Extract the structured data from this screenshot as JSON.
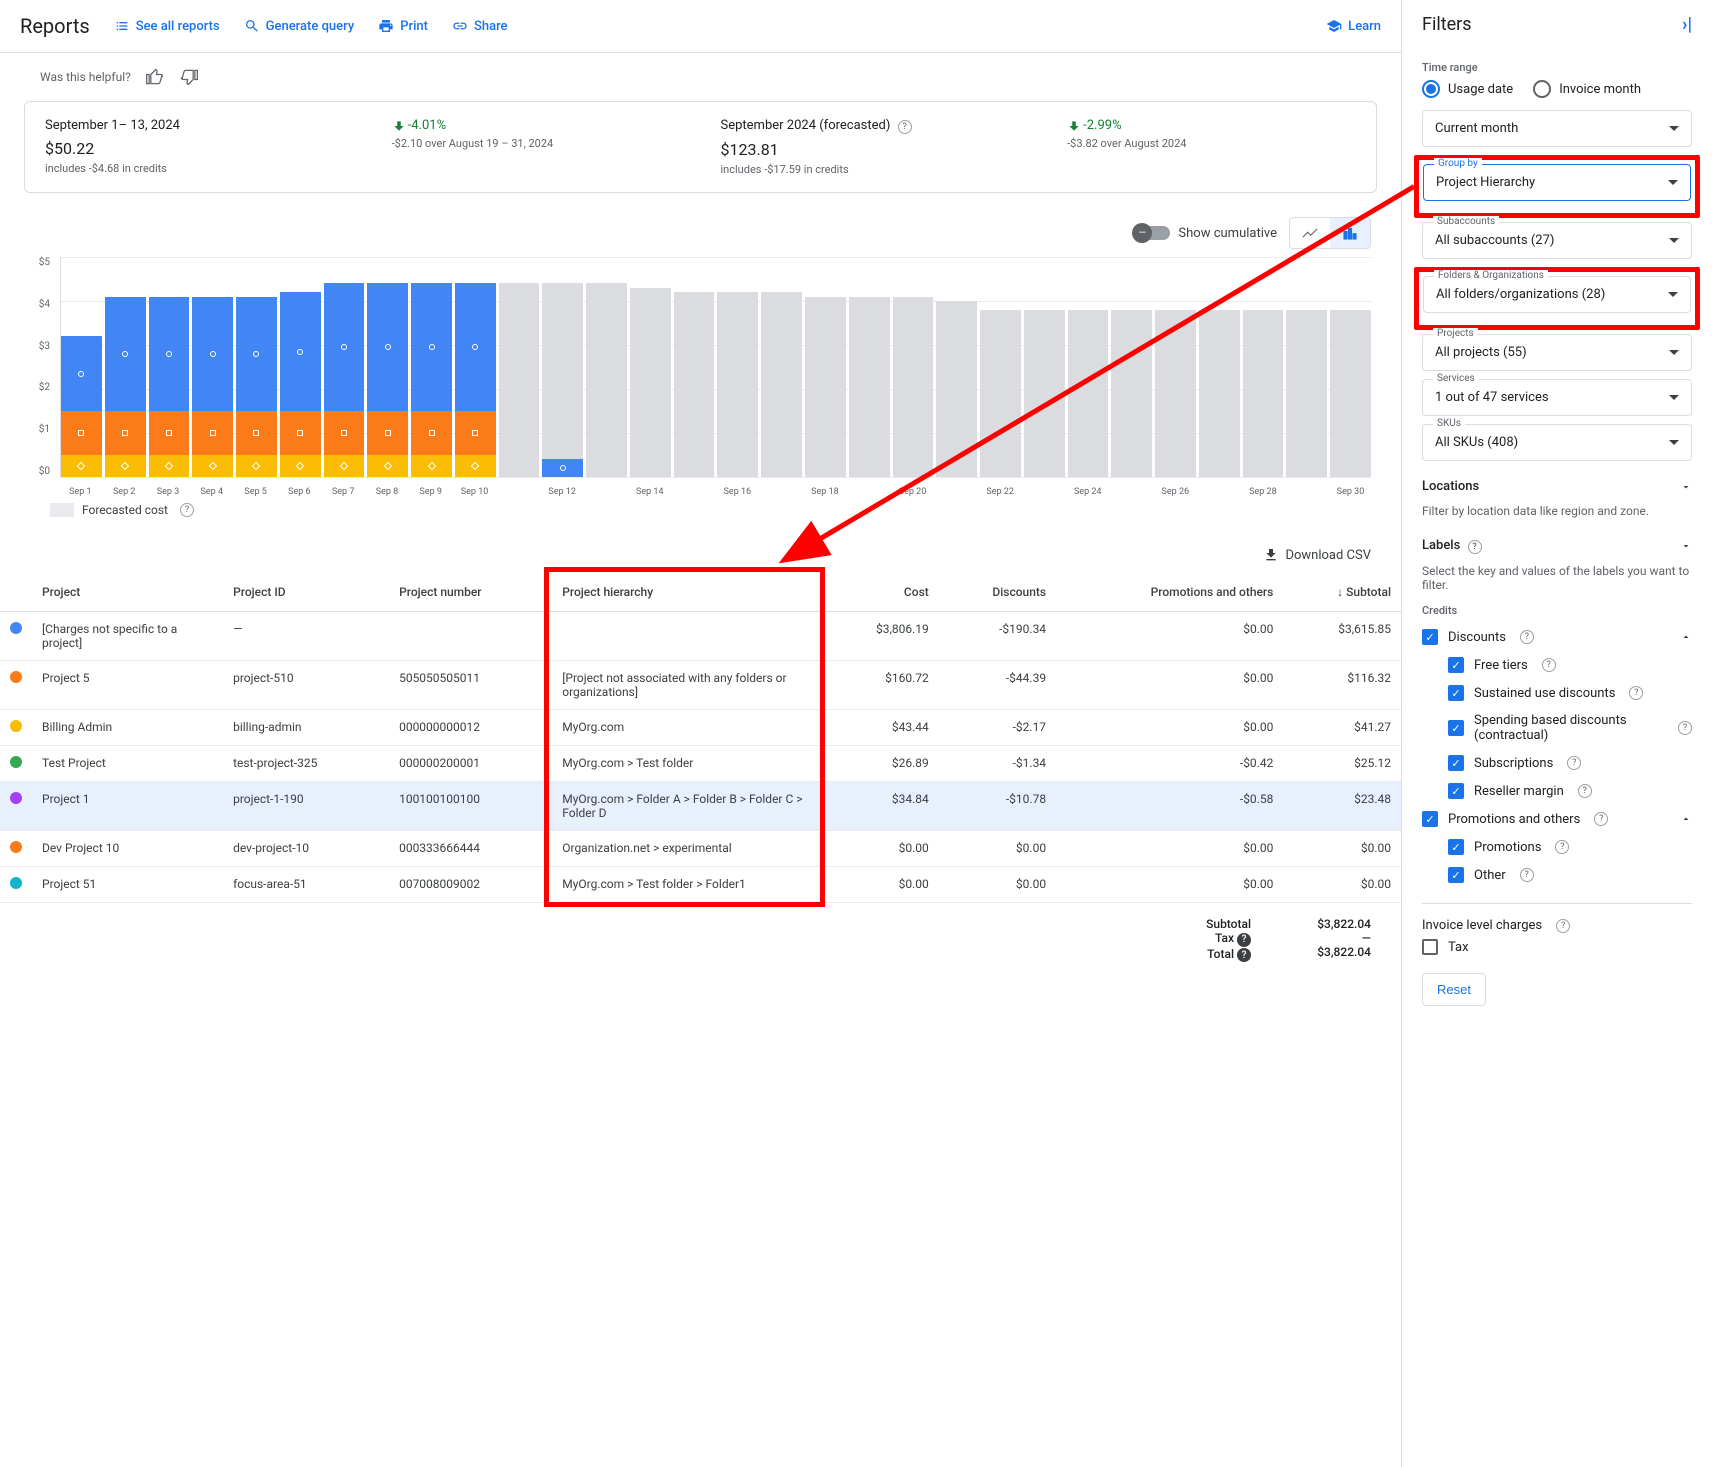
{
  "header": {
    "title": "Reports",
    "links": {
      "see_all": "See all reports",
      "generate": "Generate query",
      "print": "Print",
      "share": "Share",
      "learn": "Learn"
    }
  },
  "helpful": {
    "text": "Was this helpful?"
  },
  "summary": {
    "period1": {
      "title": "September 1– 13, 2024",
      "amount": "$50.22",
      "credits": "includes -$4.68 in credits",
      "delta": "-4.01%",
      "delta_note": "-$2.10 over August 19 – 31, 2024"
    },
    "period2": {
      "title": "September 2024 (forecasted)",
      "amount": "$123.81",
      "credits": "includes -$17.59 in credits",
      "delta": "-2.99%",
      "delta_note": "-$3.82 over August 2024"
    }
  },
  "chart_controls": {
    "cumulative": "Show cumulative"
  },
  "chart_data": {
    "type": "bar",
    "ylabel": "$",
    "ylim": [
      0,
      5
    ],
    "y_ticks": [
      "$5",
      "$4",
      "$3",
      "$2",
      "$1",
      "$0"
    ],
    "series": [
      {
        "name": "blue",
        "color": "#4285f4"
      },
      {
        "name": "orange",
        "color": "#fa7b17"
      },
      {
        "name": "yellow",
        "color": "#fbbc04"
      },
      {
        "name": "forecast",
        "color": "#dadce0"
      }
    ],
    "categories": [
      "Sep 1",
      "Sep 2",
      "Sep 3",
      "Sep 4",
      "Sep 5",
      "Sep 6",
      "Sep 7",
      "Sep 8",
      "Sep 9",
      "Sep 10",
      "Sep 11",
      "Sep 12",
      "Sep 13",
      "Sep 14",
      "Sep 15",
      "Sep 16",
      "Sep 17",
      "Sep 18",
      "Sep 19",
      "Sep 20",
      "Sep 21",
      "Sep 22",
      "Sep 23",
      "Sep 24",
      "Sep 25",
      "Sep 26",
      "Sep 27",
      "Sep 28",
      "Sep 29",
      "Sep 30"
    ],
    "bars": [
      {
        "blue": 1.7,
        "orange": 1.0,
        "yellow": 0.5,
        "forecast": 0
      },
      {
        "blue": 2.6,
        "orange": 1.0,
        "yellow": 0.5,
        "forecast": 0
      },
      {
        "blue": 2.6,
        "orange": 1.0,
        "yellow": 0.5,
        "forecast": 0
      },
      {
        "blue": 2.6,
        "orange": 1.0,
        "yellow": 0.5,
        "forecast": 0
      },
      {
        "blue": 2.6,
        "orange": 1.0,
        "yellow": 0.5,
        "forecast": 0
      },
      {
        "blue": 2.7,
        "orange": 1.0,
        "yellow": 0.5,
        "forecast": 0
      },
      {
        "blue": 2.9,
        "orange": 1.0,
        "yellow": 0.5,
        "forecast": 0
      },
      {
        "blue": 2.9,
        "orange": 1.0,
        "yellow": 0.5,
        "forecast": 0
      },
      {
        "blue": 2.9,
        "orange": 1.0,
        "yellow": 0.5,
        "forecast": 0
      },
      {
        "blue": 2.9,
        "orange": 1.0,
        "yellow": 0.5,
        "forecast": 0
      },
      {
        "blue": 0,
        "orange": 0,
        "yellow": 0,
        "forecast": 4.4
      },
      {
        "blue": 0.4,
        "orange": 0,
        "yellow": 0,
        "forecast": 4.0
      },
      {
        "blue": 0,
        "orange": 0,
        "yellow": 0,
        "forecast": 4.4
      },
      {
        "blue": 0,
        "orange": 0,
        "yellow": 0,
        "forecast": 4.3
      },
      {
        "blue": 0,
        "orange": 0,
        "yellow": 0,
        "forecast": 4.2
      },
      {
        "blue": 0,
        "orange": 0,
        "yellow": 0,
        "forecast": 4.2
      },
      {
        "blue": 0,
        "orange": 0,
        "yellow": 0,
        "forecast": 4.2
      },
      {
        "blue": 0,
        "orange": 0,
        "yellow": 0,
        "forecast": 4.1
      },
      {
        "blue": 0,
        "orange": 0,
        "yellow": 0,
        "forecast": 4.1
      },
      {
        "blue": 0,
        "orange": 0,
        "yellow": 0,
        "forecast": 4.1
      },
      {
        "blue": 0,
        "orange": 0,
        "yellow": 0,
        "forecast": 4.0
      },
      {
        "blue": 0,
        "orange": 0,
        "yellow": 0,
        "forecast": 3.8
      },
      {
        "blue": 0,
        "orange": 0,
        "yellow": 0,
        "forecast": 3.8
      },
      {
        "blue": 0,
        "orange": 0,
        "yellow": 0,
        "forecast": 3.8
      },
      {
        "blue": 0,
        "orange": 0,
        "yellow": 0,
        "forecast": 3.8
      },
      {
        "blue": 0,
        "orange": 0,
        "yellow": 0,
        "forecast": 3.8
      },
      {
        "blue": 0,
        "orange": 0,
        "yellow": 0,
        "forecast": 3.8
      },
      {
        "blue": 0,
        "orange": 0,
        "yellow": 0,
        "forecast": 3.8
      },
      {
        "blue": 0,
        "orange": 0,
        "yellow": 0,
        "forecast": 3.8
      },
      {
        "blue": 0,
        "orange": 0,
        "yellow": 0,
        "forecast": 3.8
      }
    ],
    "x_labels_shown": [
      "Sep 1",
      "Sep 2",
      "Sep 3",
      "Sep 4",
      "Sep 5",
      "Sep 6",
      "Sep 7",
      "Sep 8",
      "Sep 9",
      "Sep 10",
      "",
      "Sep 12",
      "",
      "Sep 14",
      "",
      "Sep 16",
      "",
      "Sep 18",
      "",
      "Sep 20",
      "",
      "Sep 22",
      "",
      "Sep 24",
      "",
      "Sep 26",
      "",
      "Sep 28",
      "",
      "Sep 30"
    ]
  },
  "legend": {
    "forecast": "Forecasted cost"
  },
  "download": "Download CSV",
  "table": {
    "headers": {
      "project": "Project",
      "project_id": "Project ID",
      "project_number": "Project number",
      "hierarchy": "Project hierarchy",
      "cost": "Cost",
      "discounts": "Discounts",
      "promotions": "Promotions and others",
      "subtotal": "Subtotal"
    },
    "rows": [
      {
        "color": "#4285f4",
        "project": "[Charges not specific to a project]",
        "project_id": "—",
        "project_number": "",
        "hierarchy": "",
        "cost": "$3,806.19",
        "discounts": "-$190.34",
        "promotions": "$0.00",
        "subtotal": "$3,615.85"
      },
      {
        "color": "#fa7b17",
        "project": "Project 5",
        "project_id": "project-510",
        "project_number": "505050505011",
        "hierarchy": "[Project not associated with any folders or organizations]",
        "cost": "$160.72",
        "discounts": "-$44.39",
        "promotions": "$0.00",
        "subtotal": "$116.32"
      },
      {
        "color": "#fbbc04",
        "project": "Billing Admin",
        "project_id": "billing-admin",
        "project_number": "000000000012",
        "hierarchy": "MyOrg.com",
        "cost": "$43.44",
        "discounts": "-$2.17",
        "promotions": "$0.00",
        "subtotal": "$41.27"
      },
      {
        "color": "#34a853",
        "project": "Test Project",
        "project_id": "test-project-325",
        "project_number": "000000200001",
        "hierarchy": "MyOrg.com > Test folder",
        "cost": "$26.89",
        "discounts": "-$1.34",
        "promotions": "-$0.42",
        "subtotal": "$25.12"
      },
      {
        "color": "#a142f4",
        "project": "Project 1",
        "project_id": "project-1-190",
        "project_number": "100100100100",
        "hierarchy": "MyOrg.com > Folder A > Folder B > Folder C > Folder D",
        "cost": "$34.84",
        "discounts": "-$10.78",
        "promotions": "-$0.58",
        "subtotal": "$23.48",
        "selected": true
      },
      {
        "color": "#fa7b17",
        "project": "Dev Project 10",
        "project_id": "dev-project-10",
        "project_number": "000333666444",
        "hierarchy": "Organization.net > experimental",
        "cost": "$0.00",
        "discounts": "$0.00",
        "promotions": "$0.00",
        "subtotal": "$0.00"
      },
      {
        "color": "#12b5cb",
        "project": "Project 51",
        "project_id": "focus-area-51",
        "project_number": "007008009002",
        "hierarchy": "MyOrg.com > Test folder > Folder1",
        "cost": "$0.00",
        "discounts": "$0.00",
        "promotions": "$0.00",
        "subtotal": "$0.00"
      }
    ],
    "totals": {
      "subtotal_label": "Subtotal",
      "subtotal": "$3,822.04",
      "tax_label": "Tax",
      "tax": "—",
      "total_label": "Total",
      "total": "$3,822.04"
    }
  },
  "filters": {
    "title": "Filters",
    "time_range": {
      "label": "Time range",
      "usage": "Usage date",
      "invoice": "Invoice month"
    },
    "selects": {
      "period": "Current month",
      "group_by_label": "Group by",
      "group_by": "Project Hierarchy",
      "subaccounts_label": "Subaccounts",
      "subaccounts": "All subaccounts (27)",
      "folders_label": "Folders & Organizations",
      "folders": "All folders/organizations (28)",
      "projects_label": "Projects",
      "projects": "All projects (55)",
      "services_label": "Services",
      "services": "1 out of 47 services",
      "skus_label": "SKUs",
      "skus": "All SKUs (408)"
    },
    "locations": {
      "title": "Locations",
      "desc": "Filter by location data like region and zone."
    },
    "labels": {
      "title": "Labels",
      "desc": "Select the key and values of the labels you want to filter."
    },
    "credits": {
      "title": "Credits",
      "discounts": "Discounts",
      "free_tiers": "Free tiers",
      "sustained": "Sustained use discounts",
      "spending": "Spending based discounts (contractual)",
      "subscriptions": "Subscriptions",
      "reseller": "Reseller margin",
      "promotions_others": "Promotions and others",
      "promotions": "Promotions",
      "other": "Other"
    },
    "invoice_charges": "Invoice level charges",
    "tax": "Tax",
    "reset": "Reset"
  }
}
